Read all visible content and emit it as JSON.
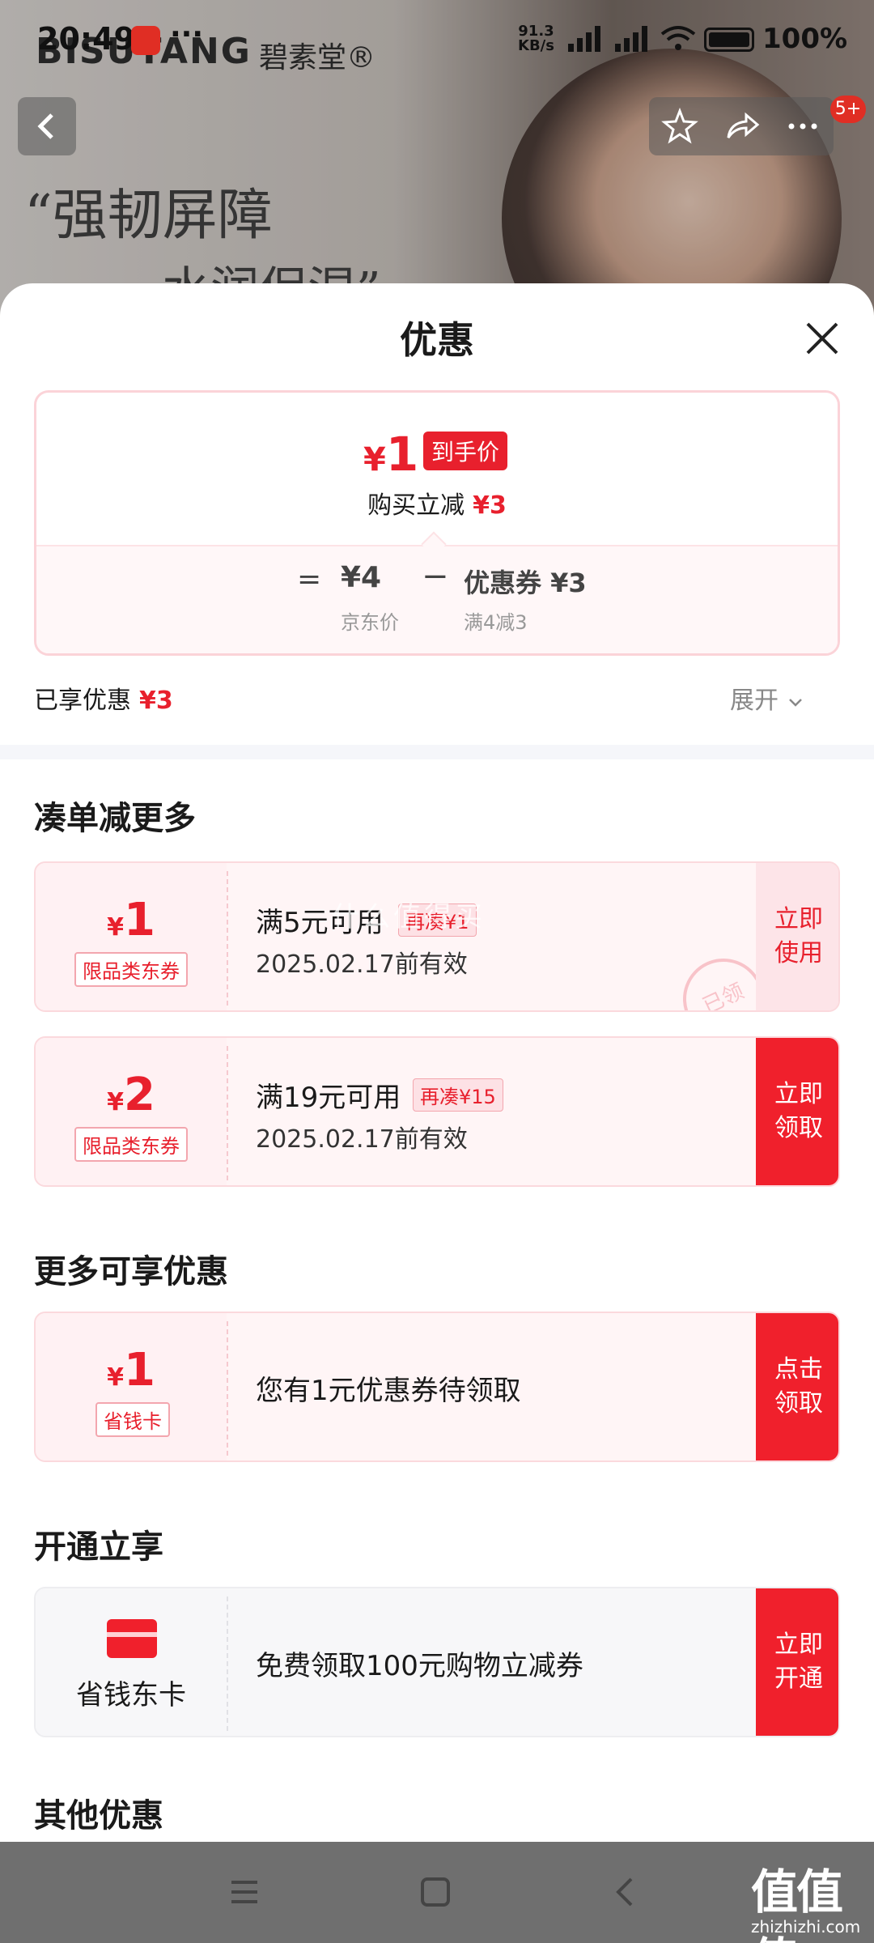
{
  "status_bar": {
    "time": "20:49",
    "dots": "···",
    "net_speed_value": "91.3",
    "net_speed_unit": "KB/s",
    "battery": "100%"
  },
  "background_page": {
    "brand_latin": "BISUTANG",
    "brand_cn": "碧素堂®",
    "slogan_line1": "“强韧屏障",
    "slogan_line2": "水润保湿”",
    "message_badge": "5+"
  },
  "sheet": {
    "title": "优惠",
    "summary": {
      "yen": "¥",
      "final_price": "1",
      "final_tag": "到手价",
      "instant_reduce_label": "购买立减",
      "instant_reduce_amount": "¥3",
      "equals": "=",
      "jd_price": "¥4",
      "jd_price_label": "京东价",
      "minus": "−",
      "coupon_amount": "优惠券 ¥3",
      "coupon_rule": "满4减3"
    },
    "enjoyed_label": "已享优惠",
    "enjoyed_amount": "¥3",
    "expand_label": "展开"
  },
  "sections": {
    "combine": {
      "title": "凑单减更多",
      "coupons": [
        {
          "yen": "¥",
          "amount": "1",
          "type": "限品类东券",
          "rule": "满5元可用",
          "extra": "再凑¥1",
          "valid": "2025.02.17前有效",
          "action": "立即\n使用",
          "stamp": "已领"
        },
        {
          "yen": "¥",
          "amount": "2",
          "type": "限品类东券",
          "rule": "满19元可用",
          "extra": "再凑¥15",
          "valid": "2025.02.17前有效",
          "action": "立即\n领取"
        }
      ]
    },
    "more": {
      "title": "更多可享优惠",
      "item": {
        "yen": "¥",
        "amount": "1",
        "type": "省钱卡",
        "text": "您有1元优惠券待领取",
        "action": "点击\n领取"
      }
    },
    "open": {
      "title": "开通立享",
      "item": {
        "name": "省钱东卡",
        "text": "免费领取100元购物立减券",
        "action": "立即\n开通"
      }
    },
    "other": {
      "title": "其他优惠"
    }
  },
  "watermark": "什么值得买",
  "site": {
    "mark": "值值值",
    "url": "zhizhizhi.com"
  },
  "colors": {
    "accent_red": "#e8202d",
    "button_red": "#f0202c",
    "nav_gray": "#6f6f6f"
  },
  "icons": [
    "back-icon",
    "star-icon",
    "share-icon",
    "more-icon",
    "close-icon",
    "chevron-down-icon",
    "card-icon",
    "menu-icon",
    "home-icon",
    "nav-back-icon"
  ]
}
